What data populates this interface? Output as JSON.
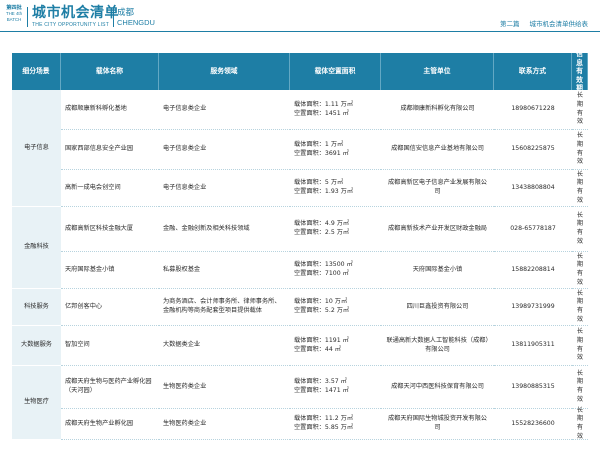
{
  "header": {
    "batch_line1": "第四批",
    "batch_line2": "THE 4th",
    "batch_line3": "BATCH",
    "title_cn": "城市机会清单",
    "title_en": "THE CITY OPPORTUNITY LIST",
    "city_cn": "成都",
    "city_en": "CHENGDU",
    "part": "第二篇",
    "section": "城市机会清单供给表"
  },
  "columns": [
    "细分场景",
    "载体名称",
    "服务领域",
    "载体空置面积",
    "主管单位",
    "联系方式",
    "信息有效期"
  ],
  "rows": [
    {
      "category": "电子信息",
      "name": "成都顺康新科孵化基地",
      "field": "电子信息类企业",
      "area1": "载体面积：1.11 万㎡",
      "area2": "空置面积：1451 ㎡",
      "unit": "成都顺康新科孵化有限公司",
      "contact": "18980671228",
      "valid": "长期有效"
    },
    {
      "category": "",
      "name": "国家西部信息安全产业园",
      "field": "电子信息类企业",
      "area1": "载体面积：1 万㎡",
      "area2": "空置面积：3691 ㎡",
      "unit": "成都国信安信息产业基地有限公司",
      "contact": "15608225875",
      "valid": "长期有效"
    },
    {
      "category": "",
      "name": "高新一成电会创空间",
      "field": "电子信息类企业",
      "area1": "载体面积：5 万㎡",
      "area2": "空置面积：1.93 万㎡",
      "unit": "成都高新区电子信息产业发展有限公司",
      "contact": "13438808804",
      "valid": "长期有效"
    },
    {
      "category": "金融科技",
      "name": "成都高新区科技金融大厦",
      "field": "金融、金融创新及相关科技领域",
      "area1": "载体面积：4.9 万㎡",
      "area2": "空置面积：2.5 万㎡",
      "unit": "成都高新技术产业开发区财政金融局",
      "contact": "028-65778187",
      "valid": "长期有效"
    },
    {
      "category": "",
      "name": "天府国际基金小镇",
      "field": "私募股权基金",
      "area1": "载体面积：13500 ㎡",
      "area2": "空置面积：7100 ㎡",
      "unit": "天府国际基金小镇",
      "contact": "15882208814",
      "valid": "长期有效"
    },
    {
      "category": "科技服务",
      "name": "亿邦创客中心",
      "field": "为商务酒店、会计师事务所、律师事务所、金融机构等商务配套型项目提供载体",
      "area1": "载体面积：10 万㎡",
      "area2": "空置面积：5.2 万㎡",
      "unit": "四川巨鑫投资有限公司",
      "contact": "13989731999",
      "valid": "长期有效"
    },
    {
      "category": "大数据服务",
      "name": "智加空间",
      "field": "大数据类企业",
      "area1": "载体面积：1191 ㎡",
      "area2": "空置面积：44 ㎡",
      "unit": "联通高新大数据人工智能科技（成都）有限公司",
      "contact": "13811905311",
      "valid": "长期有效"
    },
    {
      "category": "生物医疗",
      "name": "成都天府生物与医药产业孵化园（天河园）",
      "field": "生物医药类企业",
      "area1": "载体面积：3.57 ㎡",
      "area2": "空置面积：1471 ㎡",
      "unit": "成都天河中西医科技保育有限公司",
      "contact": "13980885315",
      "valid": "长期有效"
    },
    {
      "category": "",
      "name": "成都天府生物产业孵化园",
      "field": "生物医药类企业",
      "area1": "载体面积：11.2 万㎡",
      "area2": "空置面积：5.85 万㎡",
      "unit": "成都天府国际生物城投资开发有限公司",
      "contact": "15528236600",
      "valid": "长期有效"
    }
  ]
}
